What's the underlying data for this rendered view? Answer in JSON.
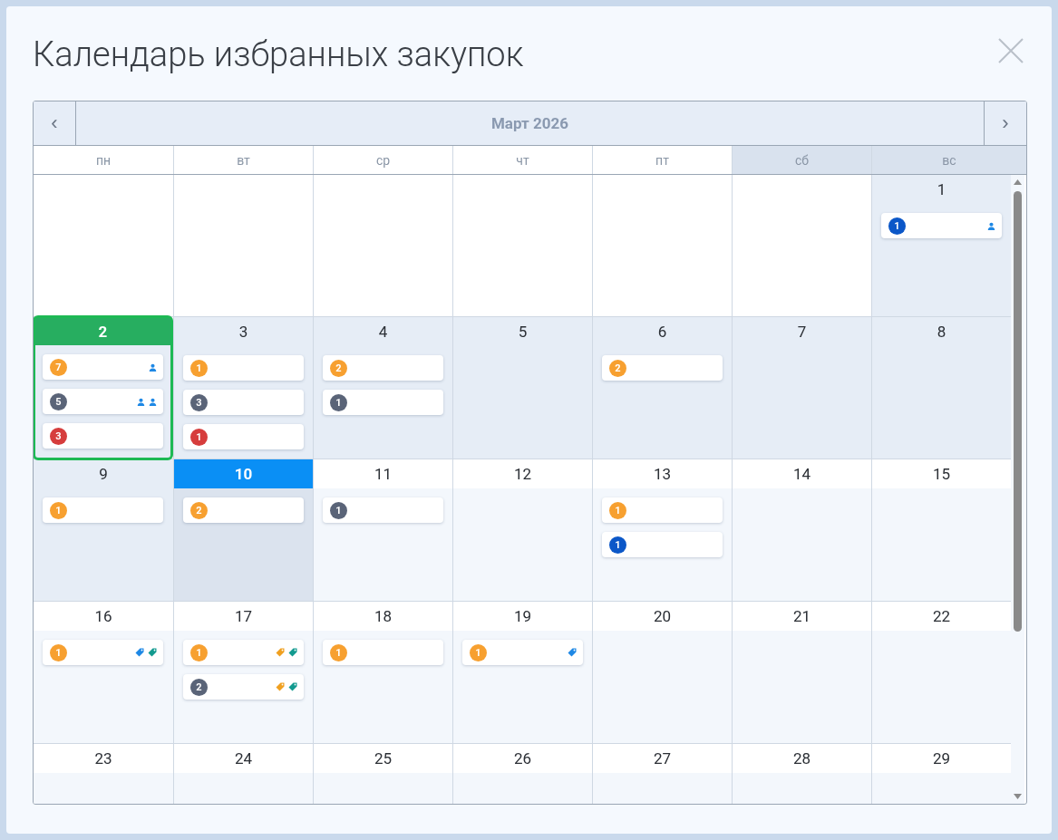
{
  "dialog": {
    "title": "Календарь избранных закупок"
  },
  "calendar": {
    "month": "Март 2026",
    "prev": "‹",
    "next": "›",
    "weekdays": [
      {
        "label": "пн",
        "weekend": false
      },
      {
        "label": "вт",
        "weekend": false
      },
      {
        "label": "ср",
        "weekend": false
      },
      {
        "label": "чт",
        "weekend": false
      },
      {
        "label": "пт",
        "weekend": false
      },
      {
        "label": "сб",
        "weekend": true
      },
      {
        "label": "вс",
        "weekend": true
      }
    ],
    "weeks": [
      {
        "days": [
          {
            "kind": "blank"
          },
          {
            "kind": "blank"
          },
          {
            "kind": "blank"
          },
          {
            "kind": "blank"
          },
          {
            "kind": "blank"
          },
          {
            "kind": "blank"
          },
          {
            "kind": "day",
            "day": "1",
            "past": true,
            "today": false,
            "selected": false,
            "events": [
              {
                "count": "1",
                "color": "#0b57c8",
                "icons": [
                  {
                    "kind": "person"
                  }
                ]
              }
            ]
          }
        ]
      },
      {
        "days": [
          {
            "kind": "day",
            "day": "2",
            "past": true,
            "today": false,
            "selected": true,
            "events": [
              {
                "count": "7",
                "color": "#f7a030",
                "icons": [
                  {
                    "kind": "person"
                  }
                ]
              },
              {
                "count": "5",
                "color": "#5a6478",
                "icons": [
                  {
                    "kind": "person"
                  },
                  {
                    "kind": "person"
                  }
                ]
              },
              {
                "count": "3",
                "color": "#d63d3d"
              }
            ]
          },
          {
            "kind": "day",
            "day": "3",
            "past": true,
            "today": false,
            "selected": false,
            "events": [
              {
                "count": "1",
                "color": "#f7a030"
              },
              {
                "count": "3",
                "color": "#5a6478"
              },
              {
                "count": "1",
                "color": "#d63d3d"
              }
            ]
          },
          {
            "kind": "day",
            "day": "4",
            "past": true,
            "today": false,
            "selected": false,
            "events": [
              {
                "count": "2",
                "color": "#f7a030"
              },
              {
                "count": "1",
                "color": "#5a6478"
              }
            ]
          },
          {
            "kind": "day",
            "day": "5",
            "past": true,
            "today": false,
            "selected": false
          },
          {
            "kind": "day",
            "day": "6",
            "past": true,
            "today": false,
            "selected": false,
            "events": [
              {
                "count": "2",
                "color": "#f7a030"
              }
            ]
          },
          {
            "kind": "day",
            "day": "7",
            "past": true,
            "today": false,
            "selected": false
          },
          {
            "kind": "day",
            "day": "8",
            "past": true,
            "today": false,
            "selected": false
          }
        ]
      },
      {
        "days": [
          {
            "kind": "day",
            "day": "9",
            "past": true,
            "today": false,
            "selected": false,
            "events": [
              {
                "count": "1",
                "color": "#f7a030"
              }
            ]
          },
          {
            "kind": "day",
            "day": "10",
            "past": false,
            "today": true,
            "selected": false,
            "events": [
              {
                "count": "2",
                "color": "#f7a030"
              }
            ]
          },
          {
            "kind": "day",
            "day": "11",
            "past": false,
            "today": false,
            "selected": false,
            "events": [
              {
                "count": "1",
                "color": "#5a6478"
              }
            ]
          },
          {
            "kind": "day",
            "day": "12",
            "past": false,
            "today": false,
            "selected": false
          },
          {
            "kind": "day",
            "day": "13",
            "past": false,
            "today": false,
            "selected": false,
            "events": [
              {
                "count": "1",
                "color": "#f7a030"
              },
              {
                "count": "1",
                "color": "#0b57c8"
              }
            ]
          },
          {
            "kind": "day",
            "day": "14",
            "past": false,
            "today": false,
            "selected": false
          },
          {
            "kind": "day",
            "day": "15",
            "past": false,
            "today": false,
            "selected": false
          }
        ]
      },
      {
        "days": [
          {
            "kind": "day",
            "day": "16",
            "past": false,
            "today": false,
            "selected": false,
            "events": [
              {
                "count": "1",
                "color": "#f7a030",
                "icons": [
                  {
                    "kind": "tag",
                    "color": "#1e88e5"
                  },
                  {
                    "kind": "tag",
                    "color": "#129a8f"
                  }
                ]
              }
            ]
          },
          {
            "kind": "day",
            "day": "17",
            "past": false,
            "today": false,
            "selected": false,
            "events": [
              {
                "count": "1",
                "color": "#f7a030",
                "icons": [
                  {
                    "kind": "tag",
                    "color": "#f0a020"
                  },
                  {
                    "kind": "tag",
                    "color": "#129a8f"
                  }
                ]
              },
              {
                "count": "2",
                "color": "#5a6478",
                "icons": [
                  {
                    "kind": "tag",
                    "color": "#f0a020"
                  },
                  {
                    "kind": "tag",
                    "color": "#129a8f"
                  }
                ]
              }
            ]
          },
          {
            "kind": "day",
            "day": "18",
            "past": false,
            "today": false,
            "selected": false,
            "events": [
              {
                "count": "1",
                "color": "#f7a030"
              }
            ]
          },
          {
            "kind": "day",
            "day": "19",
            "past": false,
            "today": false,
            "selected": false,
            "events": [
              {
                "count": "1",
                "color": "#f7a030",
                "icons": [
                  {
                    "kind": "tag",
                    "color": "#1e88e5"
                  }
                ]
              }
            ]
          },
          {
            "kind": "day",
            "day": "20",
            "past": false,
            "today": false,
            "selected": false
          },
          {
            "kind": "day",
            "day": "21",
            "past": false,
            "today": false,
            "selected": false
          },
          {
            "kind": "day",
            "day": "22",
            "past": false,
            "today": false,
            "selected": false
          }
        ]
      },
      {
        "days": [
          {
            "kind": "day",
            "day": "23",
            "past": false,
            "today": false,
            "selected": false
          },
          {
            "kind": "day",
            "day": "24",
            "past": false,
            "today": false,
            "selected": false
          },
          {
            "kind": "day",
            "day": "25",
            "past": false,
            "today": false,
            "selected": false
          },
          {
            "kind": "day",
            "day": "26",
            "past": false,
            "today": false,
            "selected": false
          },
          {
            "kind": "day",
            "day": "27",
            "past": false,
            "today": false,
            "selected": false
          },
          {
            "kind": "day",
            "day": "28",
            "past": false,
            "today": false,
            "selected": false
          },
          {
            "kind": "day",
            "day": "29",
            "past": false,
            "today": false,
            "selected": false
          }
        ]
      }
    ]
  }
}
